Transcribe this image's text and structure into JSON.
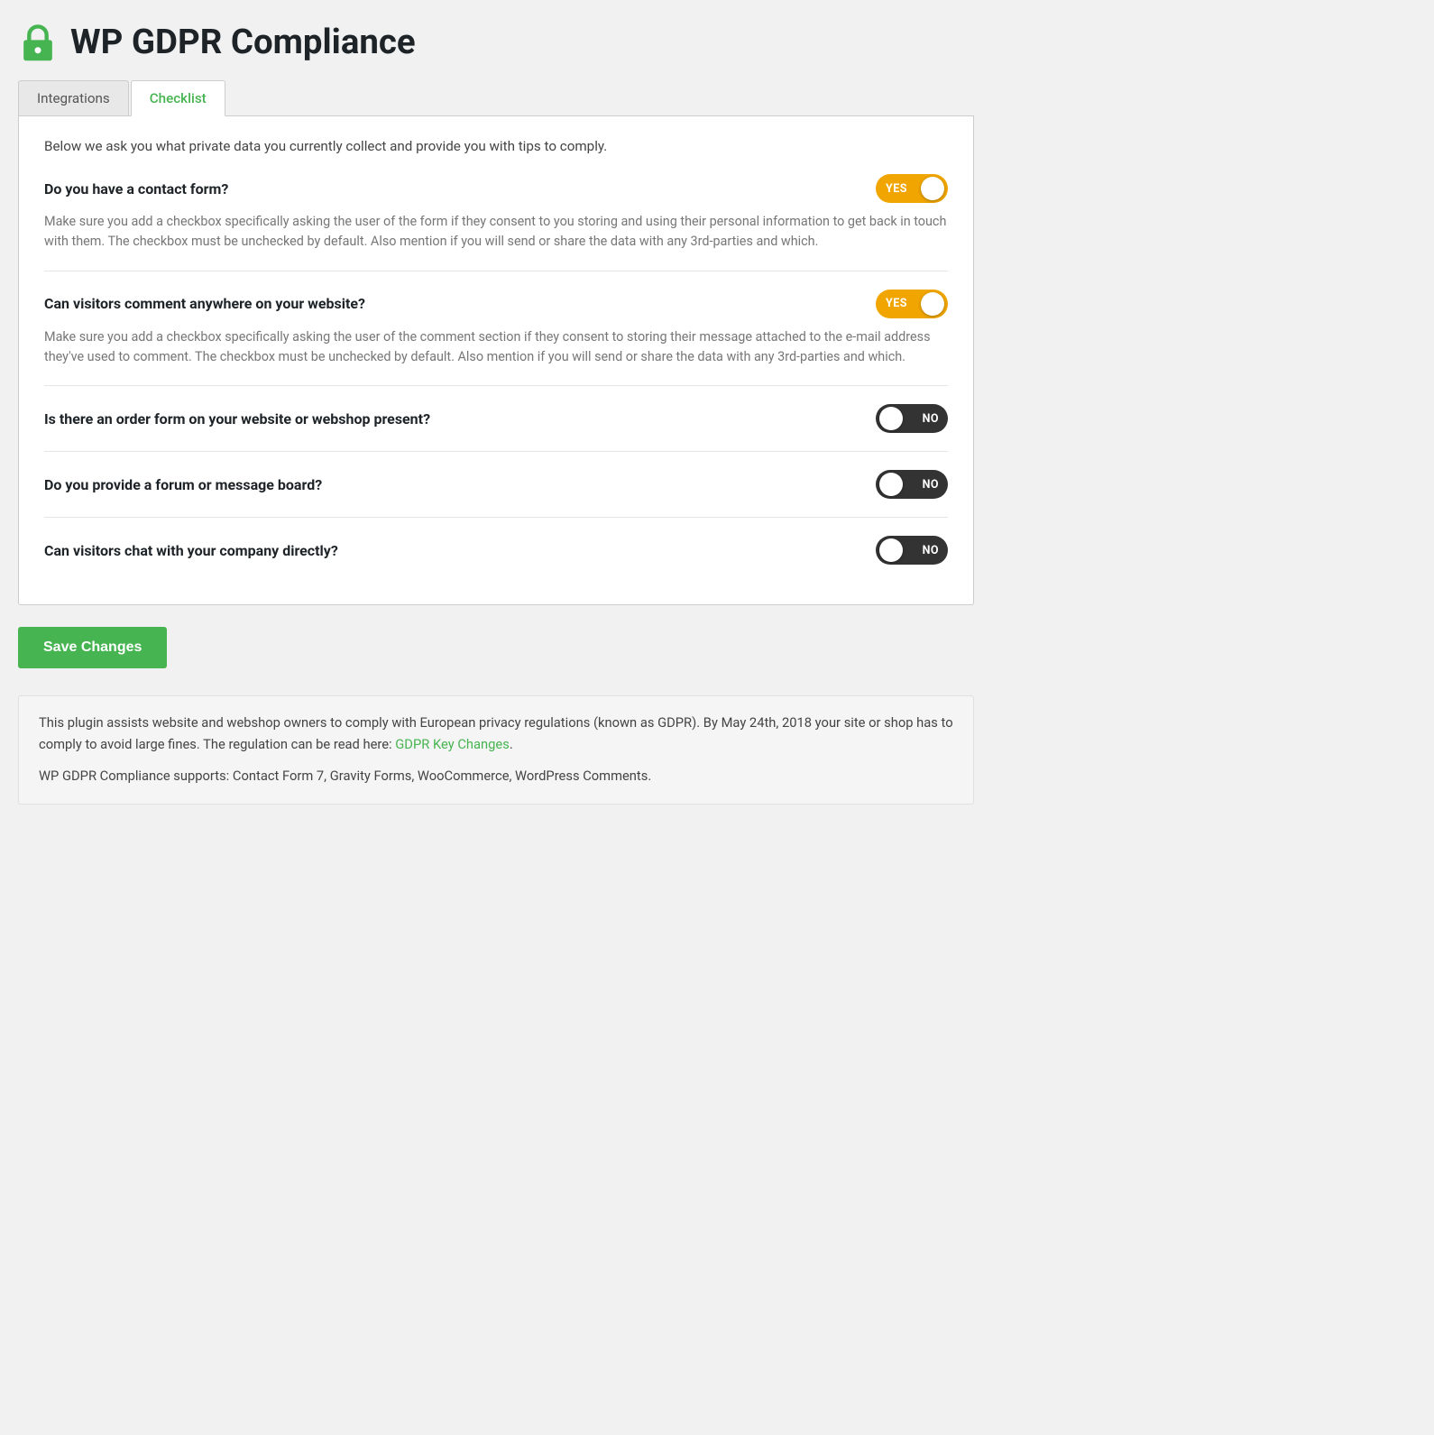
{
  "header": {
    "title": "WP GDPR Compliance",
    "lock_icon_label": "lock"
  },
  "tabs": [
    {
      "id": "integrations",
      "label": "Integrations",
      "active": false
    },
    {
      "id": "checklist",
      "label": "Checklist",
      "active": true
    }
  ],
  "checklist": {
    "description": "Below we ask you what private data you currently collect and provide you with tips to comply.",
    "items": [
      {
        "id": "contact_form",
        "question": "Do you have a contact form?",
        "toggle_state": "yes",
        "toggle_label": "YES",
        "has_description": true,
        "description": "Make sure you add a checkbox specifically asking the user of the form if they consent to you storing and using their personal information to get back in touch with them. The checkbox must be unchecked by default. Also mention if you will send or share the data with any 3rd-parties and which."
      },
      {
        "id": "comments",
        "question": "Can visitors comment anywhere on your website?",
        "toggle_state": "yes",
        "toggle_label": "YES",
        "has_description": true,
        "description": "Make sure you add a checkbox specifically asking the user of the comment section if they consent to storing their message attached to the e-mail address they've used to comment. The checkbox must be unchecked by default. Also mention if you will send or share the data with any 3rd-parties and which."
      },
      {
        "id": "order_form",
        "question": "Is there an order form on your website or webshop present?",
        "toggle_state": "no",
        "toggle_label": "NO",
        "has_description": false,
        "description": ""
      },
      {
        "id": "forum",
        "question": "Do you provide a forum or message board?",
        "toggle_state": "no",
        "toggle_label": "NO",
        "has_description": false,
        "description": ""
      },
      {
        "id": "chat",
        "question": "Can visitors chat with your company directly?",
        "toggle_state": "no",
        "toggle_label": "NO",
        "has_description": false,
        "description": ""
      }
    ]
  },
  "save_button": {
    "label": "Save Changes"
  },
  "footer": {
    "paragraph1_text": "This plugin assists website and webshop owners to comply with European privacy regulations (known as GDPR). By May 24th, 2018 your site or shop has to comply to avoid large fines. The regulation can be read here: ",
    "paragraph1_link_text": "GDPR Key Changes",
    "paragraph1_link_href": "#",
    "paragraph1_end": ".",
    "paragraph2": "WP GDPR Compliance supports: Contact Form 7, Gravity Forms, WooCommerce, WordPress Comments."
  }
}
